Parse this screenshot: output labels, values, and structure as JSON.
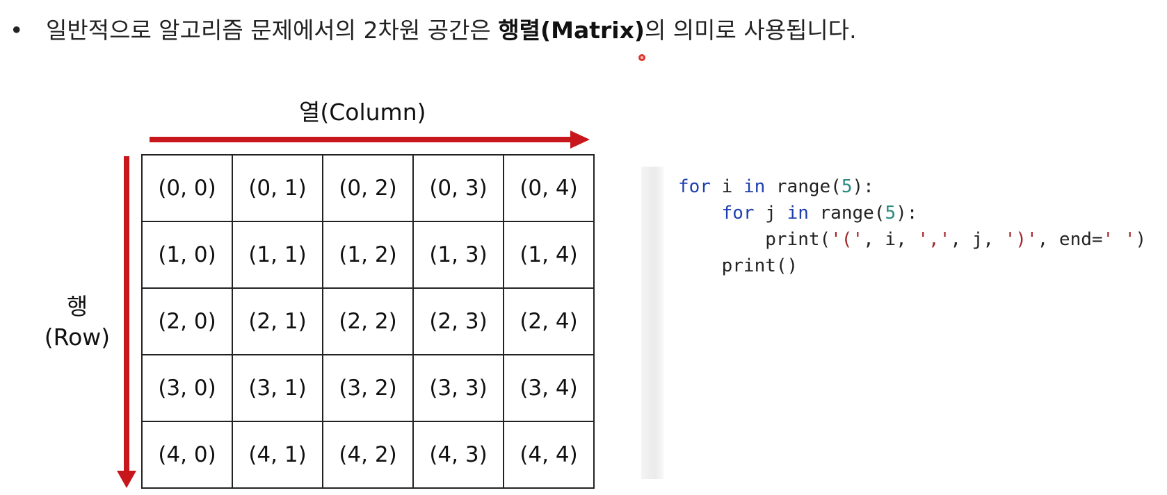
{
  "heading": {
    "bullet": "•",
    "text_before": "일반적으로 알고리즘 문제에서의 2차원 공간은 ",
    "bold_text": "행렬(Matrix)",
    "text_after": "의 의미로 사용됩니다."
  },
  "diagram": {
    "column_label": "열(Column)",
    "row_label_line1": "행",
    "row_label_line2": "(Row)",
    "arrow_color": "#c8161d",
    "cells": [
      [
        "(0, 0)",
        "(0, 1)",
        "(0, 2)",
        "(0, 3)",
        "(0, 4)"
      ],
      [
        "(1, 0)",
        "(1, 1)",
        "(1, 2)",
        "(1, 3)",
        "(1, 4)"
      ],
      [
        "(2, 0)",
        "(2, 1)",
        "(2, 2)",
        "(2, 3)",
        "(2, 4)"
      ],
      [
        "(3, 0)",
        "(3, 1)",
        "(3, 2)",
        "(3, 3)",
        "(3, 4)"
      ],
      [
        "(4, 0)",
        "(4, 1)",
        "(4, 2)",
        "(4, 3)",
        "(4, 4)"
      ]
    ]
  },
  "code": {
    "line1": {
      "kw1": "for",
      "mid": " i ",
      "kw2": "in",
      "call": " range(",
      "num": "5",
      "end": "):"
    },
    "line2": {
      "indent": "    ",
      "kw1": "for",
      "mid": " j ",
      "kw2": "in",
      "call": " range(",
      "num": "5",
      "end": "):"
    },
    "line3": {
      "indent": "        ",
      "fn": "print(",
      "s1": "'('",
      "sep1": ", i, ",
      "s2": "','",
      "sep2": ", j, ",
      "s3": "')'",
      "sep3": ", end=",
      "s4": "' '",
      "end": ")"
    },
    "line4": {
      "indent": "    ",
      "fn": "print()"
    }
  }
}
